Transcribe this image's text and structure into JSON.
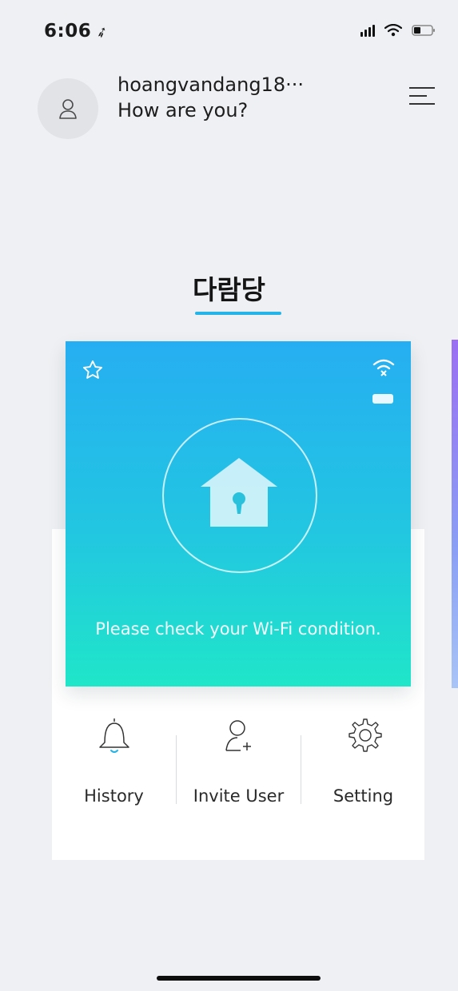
{
  "status_bar": {
    "time": "6:06",
    "location_icon": "location-arrow-icon",
    "signal_icon": "signal-bars-icon",
    "wifi_icon": "wifi-icon",
    "battery_icon": "battery-icon"
  },
  "header": {
    "avatar_icon": "user-avatar-icon",
    "user_name": "hoangvandang18···",
    "greeting": "How are you?",
    "menu_icon": "hamburger-menu-icon"
  },
  "place": {
    "title": "다람당",
    "underline_color": "#26b3e8"
  },
  "device_card": {
    "favorite_icon": "star-outline-icon",
    "wifi_icon": "wifi-warning-icon",
    "battery_icon": "battery-icon",
    "lock_icon": "house-lock-icon",
    "message": "Please check your Wi-Fi condition.",
    "gradient_top": "#26aef2",
    "gradient_bottom": "#20e6c9"
  },
  "actions": [
    {
      "label": "History",
      "icon": "bell-icon"
    },
    {
      "label": "Invite User",
      "icon": "add-user-icon"
    },
    {
      "label": "Setting",
      "icon": "gear-icon"
    }
  ]
}
